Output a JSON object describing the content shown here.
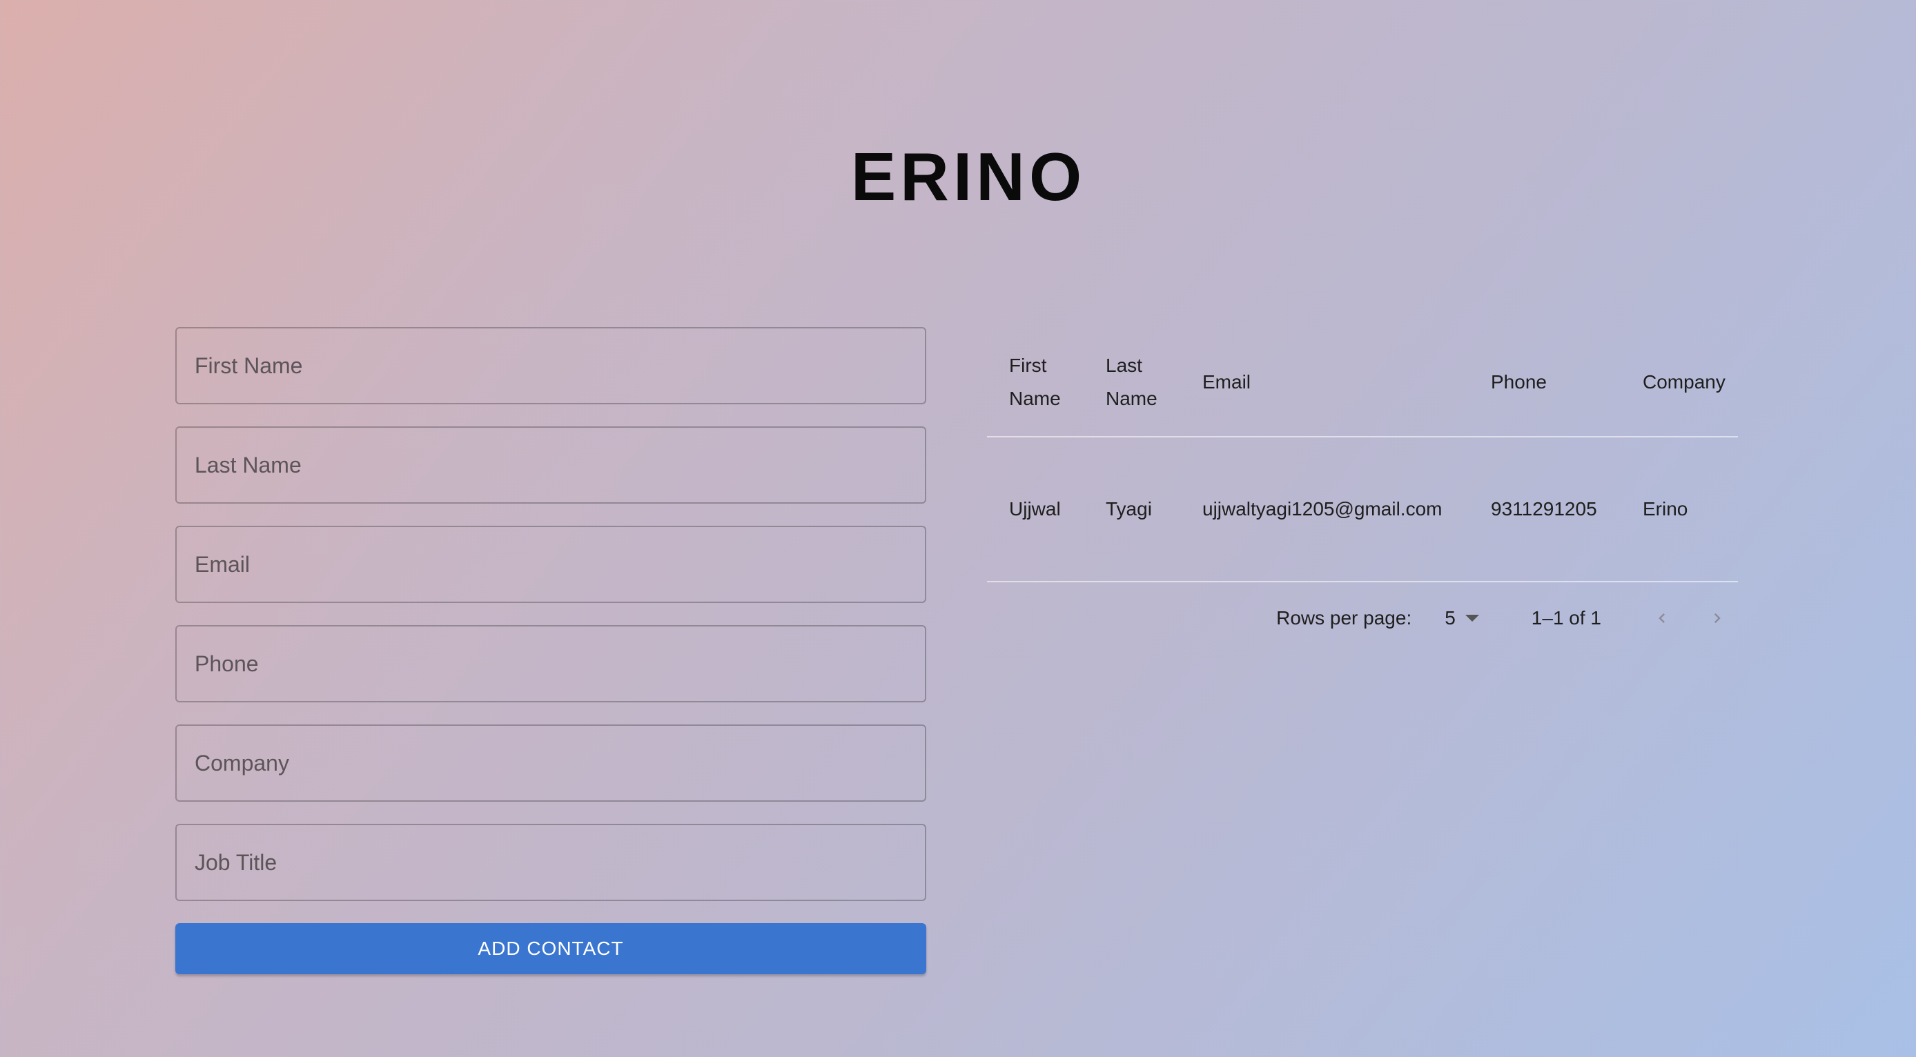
{
  "app": {
    "title": "ERINO"
  },
  "form": {
    "fields": {
      "first_name_placeholder": "First Name",
      "last_name_placeholder": "Last Name",
      "email_placeholder": "Email",
      "phone_placeholder": "Phone",
      "company_placeholder": "Company",
      "job_title_placeholder": "Job Title"
    },
    "submit_label": "ADD CONTACT"
  },
  "table": {
    "headers": {
      "first_name_line1": "First",
      "first_name_line2": "Name",
      "last_name_line1": "Last",
      "last_name_line2": "Name",
      "email": "Email",
      "phone": "Phone",
      "company": "Company"
    },
    "rows": [
      {
        "first_name": "Ujjwal",
        "last_name": "Tyagi",
        "email": "ujjwaltyagi1205@gmail.com",
        "phone": "9311291205",
        "company": "Erino"
      }
    ],
    "pagination": {
      "rows_per_page_label": "Rows per page:",
      "rows_per_page_value": "5",
      "range_text": "1–1 of 1"
    }
  },
  "icons": {
    "dropdown": "caret-down-icon",
    "previous": "chevron-left-icon",
    "next": "chevron-right-icon"
  },
  "colors": {
    "primary_button": "#3a76d0",
    "title_text": "#0a0a0a"
  }
}
